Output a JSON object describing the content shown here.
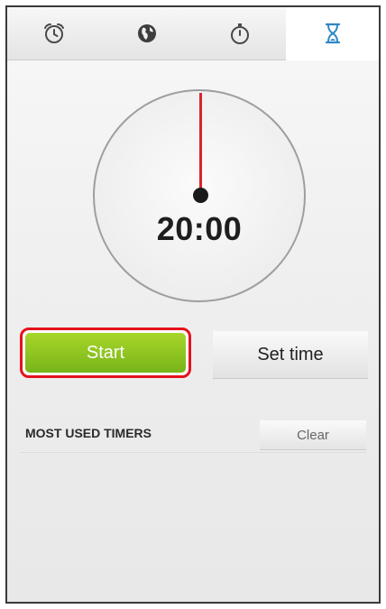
{
  "tabs": [
    {
      "icon": "alarm-clock-icon",
      "label": "",
      "active": false
    },
    {
      "icon": "world-clock-icon",
      "label": "",
      "active": false
    },
    {
      "icon": "stopwatch-icon",
      "label": "",
      "active": false
    },
    {
      "icon": "hourglass-timer-icon",
      "label": "",
      "active": true
    }
  ],
  "timer": {
    "display": "20:00"
  },
  "actions": {
    "start_label": "Start",
    "set_time_label": "Set time"
  },
  "most_used": {
    "title": "MOST USED TIMERS",
    "clear_label": "Clear"
  },
  "colors": {
    "accent_blue": "#2f86c6",
    "start_green": "#8cc420",
    "highlight_red": "#e4121c",
    "hand_red": "#d8242c"
  }
}
